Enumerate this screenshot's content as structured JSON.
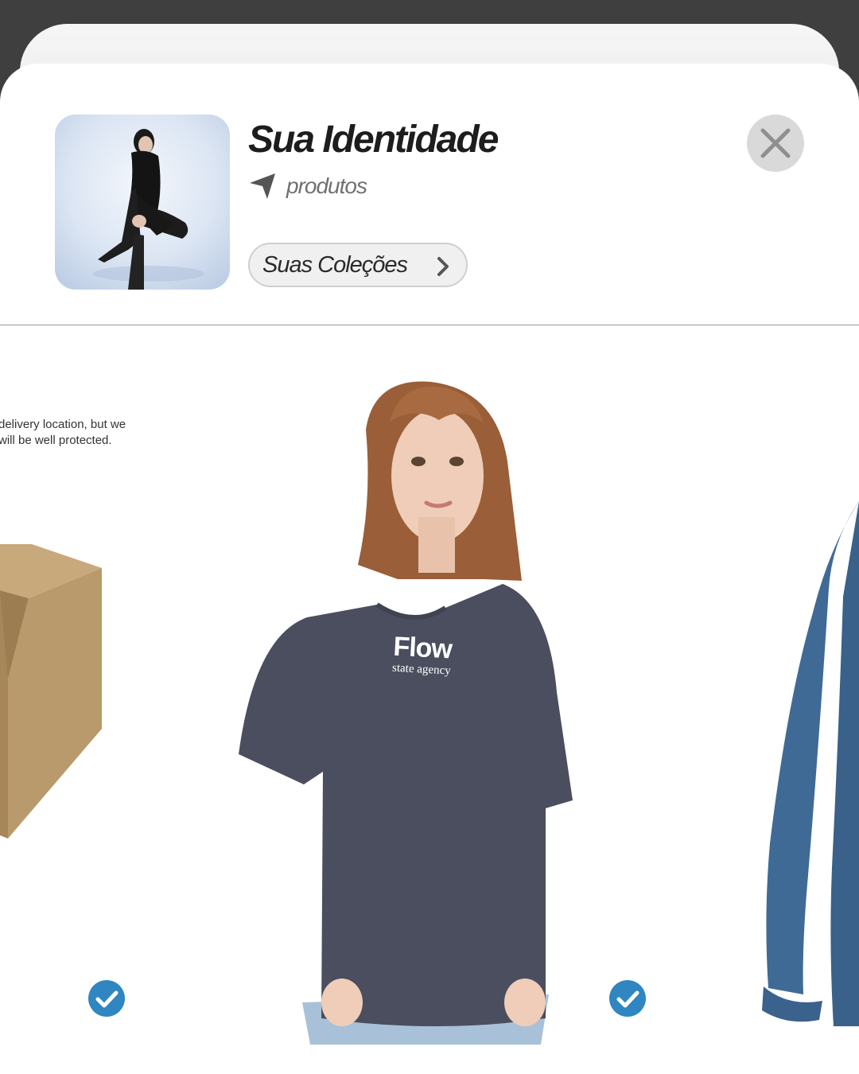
{
  "header": {
    "title": "Sua Identidade",
    "subtitle": "produtos",
    "collections_button": "Suas Coleções"
  },
  "icons": {
    "navigation": "location-arrow-icon",
    "chevron": "chevron-right-icon",
    "close": "close-icon",
    "check": "check-circle-icon"
  },
  "products": {
    "shipping_note": [
      "delivery location, but we",
      "will be well protected."
    ],
    "tshirt_logo_main": "Flow",
    "tshirt_logo_sub": "state agency"
  },
  "colors": {
    "check_blue": "#2f86c0",
    "tshirt": "#4a4e5e",
    "sweatshirt": "#3f6a96",
    "box": "#b89a6e"
  }
}
